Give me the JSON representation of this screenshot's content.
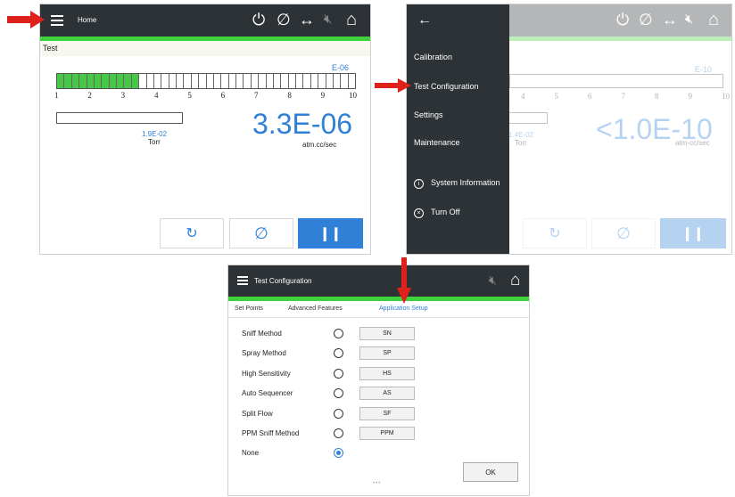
{
  "screen1": {
    "header": {
      "title": "Home"
    },
    "status_strip": "Test",
    "exponent_label": "E-06",
    "bar": {
      "segments_total": 40,
      "segments_lit": 11,
      "ticks": [
        "1",
        "2",
        "3",
        "4",
        "5",
        "6",
        "7",
        "8",
        "9",
        "10"
      ]
    },
    "pressure": {
      "value": "1.9E-02",
      "unit": "Torr"
    },
    "leak_rate": {
      "value": "3.3E-06",
      "unit": "atm.cc/sec"
    }
  },
  "screen2": {
    "exponent_label": "E-10",
    "ticks": [
      "4",
      "5",
      "6",
      "7",
      "8",
      "9",
      "10"
    ],
    "pressure": {
      "value": "1.4E-02",
      "unit": "Torr"
    },
    "leak_rate": {
      "value": "<1.0E-10",
      "unit": "atm-cc/sec"
    },
    "menu": {
      "items": [
        "Calibration",
        "Test Configuration",
        "Settings",
        "Maintenance"
      ],
      "system_information": "System Information",
      "turn_off": "Turn Off"
    }
  },
  "screen3": {
    "header": {
      "title": "Test Configuration"
    },
    "tabs": [
      "Set Points",
      "Advanced Features",
      "Application Setup"
    ],
    "active_tab": "Application Setup",
    "methods": [
      {
        "label": "Sniff Method",
        "code": "SN",
        "selected": false
      },
      {
        "label": "Spray Method",
        "code": "SP",
        "selected": false
      },
      {
        "label": "High Sensitivity",
        "code": "HS",
        "selected": false
      },
      {
        "label": "Auto Sequencer",
        "code": "AS",
        "selected": false
      },
      {
        "label": "Split Flow",
        "code": "SF",
        "selected": false
      },
      {
        "label": "PPM Sniff Method",
        "code": "PPM",
        "selected": false
      },
      {
        "label": "None",
        "code": "",
        "selected": true
      }
    ],
    "ok_label": "OK",
    "page_dots": "•••"
  },
  "colors": {
    "accent": "#2f80d6",
    "green": "#3ed33e",
    "topbar": "#2c3235",
    "arrow": "#e0201b"
  },
  "icons": [
    "hamburger-icon",
    "power-icon",
    "zero-icon",
    "swap-arrows-icon",
    "mute-icon",
    "home-icon",
    "back-arrow-icon",
    "refresh-icon",
    "pause-icon",
    "info-icon",
    "close-circle-icon"
  ]
}
